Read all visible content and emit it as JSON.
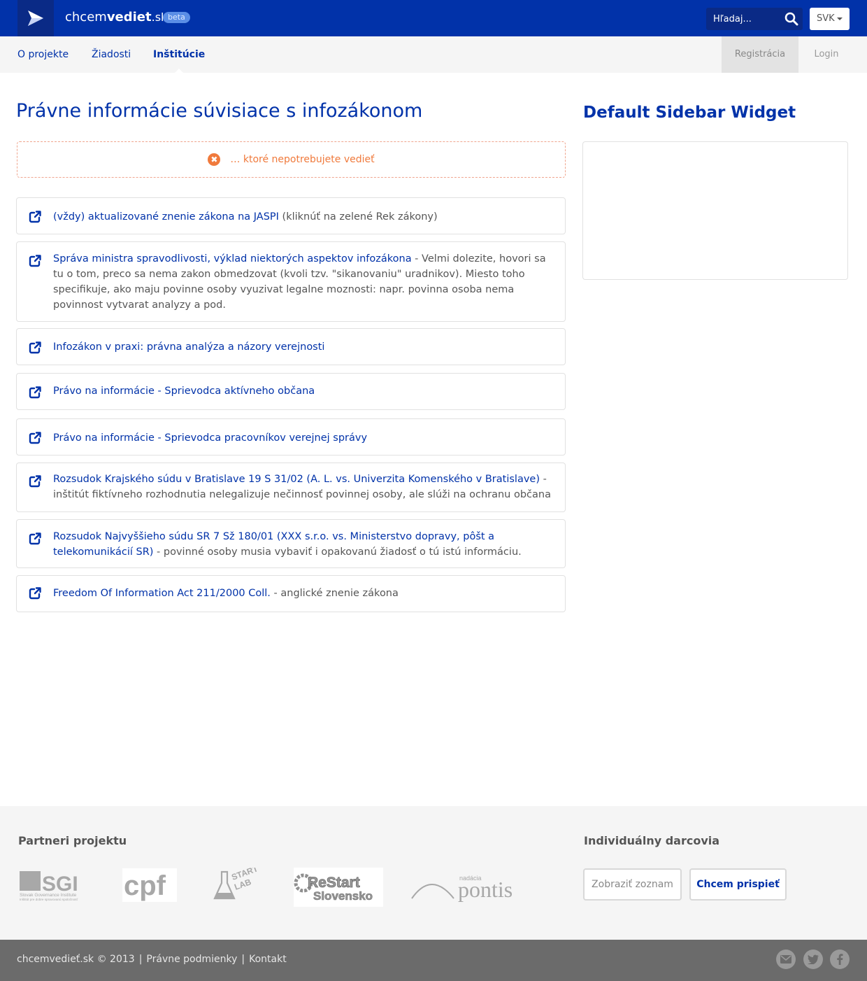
{
  "header": {
    "brand_prefix": "chcem",
    "brand_bold": "vediet",
    "brand_tld": ".sk",
    "badge": "beta",
    "search_placeholder": "Hľadaj...",
    "language": "SVK"
  },
  "nav": {
    "items": [
      "O projekte",
      "Žiadosti",
      "Inštitúcie"
    ],
    "active": "Inštitúcie",
    "register": "Registrácia",
    "login": "Login"
  },
  "main": {
    "title": "Právne informácie súvisiace s infozákonom",
    "alert": "… ktoré nepotrebujete vedieť",
    "links": [
      {
        "link": "(vždy) aktualizované znenie zákona na JASPI",
        "note": " (kliknúť na zelené Rek zákony)"
      },
      {
        "link": "Správa ministra spravodlivosti, výklad niektorých aspektov infozákona",
        "note": " - Velmi dolezite, hovori sa tu o tom, preco sa nema zakon obmedzovat (kvoli tzv. \"sikanovaniu\" uradnikov). Miesto toho specifikuje, ako maju povinne osoby vyuzivat legalne moznosti: napr. povinna osoba nema povinnost vytvarat analyzy a pod."
      },
      {
        "link": "Infozákon v praxi: právna analýza a názory verejnosti",
        "note": ""
      },
      {
        "link": "Právo na informácie - Sprievodca aktívneho občana",
        "note": ""
      },
      {
        "link": "Právo na informácie - Sprievodca pracovníkov verejnej správy",
        "note": ""
      },
      {
        "link": "Rozsudok Krajského súdu v Bratislave 19 S 31/02 (A. L. vs. Univerzita Komenského v Bratislave)",
        "note": " - inštitút fiktívneho rozhodnutia nelegalizuje nečinnosť povinnej osoby, ale slúži na ochranu občana"
      },
      {
        "link": "Rozsudok Najvyššieho súdu SR 7 Sž 180/01 (XXX s.r.o. vs. Ministerstvo dopravy, pôšt a telekomunikácií SR)",
        "note": " - povinné osoby musia vybaviť i opakovanú žiadosť o tú istú informáciu."
      },
      {
        "link": "Freedom Of Information Act 211/2000 Coll.",
        "note": " - anglické znenie zákona"
      }
    ]
  },
  "sidebar": {
    "title": "Default Sidebar Widget"
  },
  "footer": {
    "partners_heading": "Partneri projektu",
    "partners": {
      "sgi": "SGI",
      "sgi_sub": "Slovak Governance Institute",
      "sgi_sub2": "Inštitút pre dobre spravovanú spoločnosť",
      "cpf": "cpf",
      "start1": "START",
      "start2": "LAB",
      "restart1": "ReStart",
      "restart2": "Slovensko",
      "pontis_small": "nadácia",
      "pontis": "pontis"
    },
    "donors_heading": "Individuálny darcovia",
    "list_button": "Zobraziť zoznam",
    "donate_button": "Chcem prispieť",
    "copyright": "chcemvedieť.sk © 2013",
    "separator": "|",
    "legal": "Právne podmienky",
    "contact": "Kontakt",
    "social": [
      "mail-icon",
      "twitter-icon",
      "facebook-icon"
    ]
  },
  "colors": {
    "brand_blue": "#0132a9",
    "alert_orange": "#f07a3c",
    "footer_gray": "#6b6b6b"
  }
}
